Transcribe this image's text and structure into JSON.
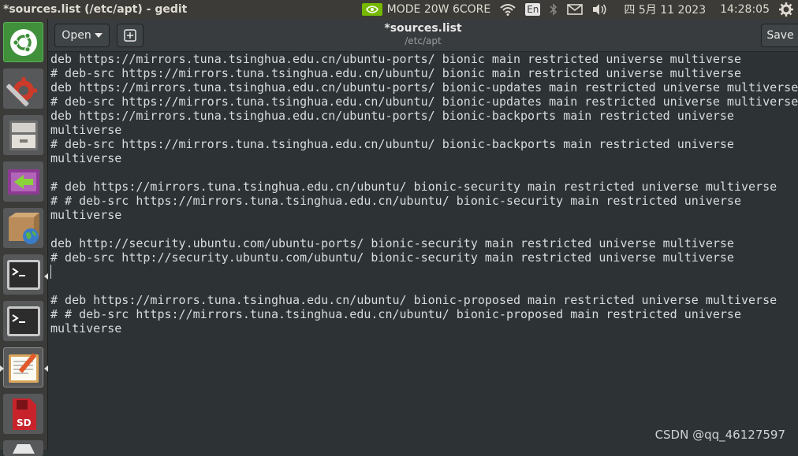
{
  "top_panel": {
    "window_title": "*sources.list (/etc/apt) - gedit",
    "power_mode": "MODE 20W 6CORE",
    "keyboard_layout": "En",
    "date": "四 5月 11 2023",
    "time": "14:28:05",
    "icons": [
      "nvidia-icon",
      "wifi-icon",
      "bluetooth-icon",
      "mail-icon",
      "volume-icon",
      "settings-gear-icon"
    ]
  },
  "launcher": {
    "items": [
      "ubuntu-dash",
      "system-settings",
      "files",
      "software-updater",
      "software-properties",
      "terminal",
      "terminal",
      "text-editor",
      "sd-card-tool",
      "more"
    ]
  },
  "header": {
    "open_label": "Open",
    "title": "*sources.list",
    "path": "/etc/apt",
    "save_label": "Save"
  },
  "editor": {
    "lines": [
      "deb https://mirrors.tuna.tsinghua.edu.cn/ubuntu-ports/ bionic main restricted universe multiverse",
      "# deb-src https://mirrors.tuna.tsinghua.edu.cn/ubuntu/ bionic main restricted universe multiverse",
      "deb https://mirrors.tuna.tsinghua.edu.cn/ubuntu-ports/ bionic-updates main restricted universe multiverse",
      "# deb-src https://mirrors.tuna.tsinghua.edu.cn/ubuntu/ bionic-updates main restricted universe multiverse",
      "deb https://mirrors.tuna.tsinghua.edu.cn/ubuntu-ports/ bionic-backports main restricted universe",
      "multiverse",
      "# deb-src https://mirrors.tuna.tsinghua.edu.cn/ubuntu/ bionic-backports main restricted universe",
      "multiverse",
      "",
      "# deb https://mirrors.tuna.tsinghua.edu.cn/ubuntu/ bionic-security main restricted universe multiverse",
      "# # deb-src https://mirrors.tuna.tsinghua.edu.cn/ubuntu/ bionic-security main restricted universe",
      "multiverse",
      "",
      "deb http://security.ubuntu.com/ubuntu-ports/ bionic-security main restricted universe multiverse",
      "# deb-src http://security.ubuntu.com/ubuntu/ bionic-security main restricted universe multiverse",
      "",
      "",
      "# deb https://mirrors.tuna.tsinghua.edu.cn/ubuntu/ bionic-proposed main restricted universe multiverse",
      "# # deb-src https://mirrors.tuna.tsinghua.edu.cn/ubuntu/ bionic-proposed main restricted universe",
      "multiverse"
    ]
  },
  "watermark": "CSDN @qq_46127597",
  "colors": {
    "panel_bg": "#3c3b37",
    "launcher_bg": "#3b3c3a",
    "editor_bg": "#2d3234",
    "text": "#d9dcdd"
  }
}
